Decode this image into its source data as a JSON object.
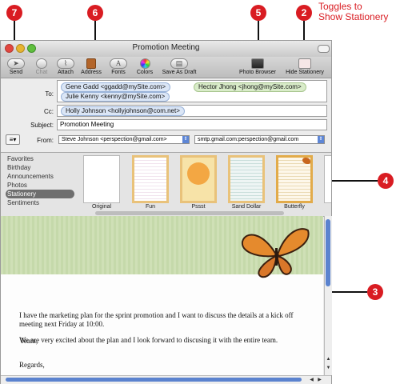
{
  "annotation_text": "Toggles to\nShow Stationery",
  "callouts": [
    "7",
    "6",
    "5",
    "2",
    "4",
    "3"
  ],
  "window": {
    "title": "Promotion Meeting"
  },
  "toolbar": {
    "items": [
      {
        "label": "Send",
        "icon": "send-icon"
      },
      {
        "label": "Chat",
        "icon": "chat-icon"
      },
      {
        "label": "Attach",
        "icon": "paperclip-icon"
      },
      {
        "label": "Address",
        "icon": "address-book-icon"
      },
      {
        "label": "Fonts",
        "icon": "fonts-icon"
      },
      {
        "label": "Colors",
        "icon": "colors-icon"
      },
      {
        "label": "Save As Draft",
        "icon": "draft-icon"
      },
      {
        "label": "Photo Browser",
        "icon": "photo-browser-icon"
      },
      {
        "label": "Hide Stationery",
        "icon": "stationery-icon"
      }
    ]
  },
  "headers": {
    "to_label": "To:",
    "to_tokens": [
      "Gene Gadd <ggadd@mySite.com>",
      "Hector Jhong <jhong@mySite.com>",
      "Julie Kenny <kenny@mySite.com>"
    ],
    "cc_label": "Cc:",
    "cc_tokens": [
      "Holly Johnson <hollyjohnson@com.net>"
    ],
    "subject_label": "Subject:",
    "subject_value": "Promotion Meeting",
    "from_label": "From:",
    "from_value": "Steve Johnson <perspection@gmail.com>",
    "smtp_value": "smtp.gmail.com:perspection@gmail.com"
  },
  "stationery": {
    "categories": [
      "Favorites",
      "Birthday",
      "Announcements",
      "Photos",
      "Stationery",
      "Sentiments"
    ],
    "selected_category": "Stationery",
    "templates": [
      "Original",
      "Fun",
      "Pssst",
      "Sand Dollar",
      "Butterfly"
    ]
  },
  "message": {
    "greeting": "Team,",
    "paragraph1": "I have the marketing plan for the sprint promotion and I want to discuss the details at a kick off meeting next Friday at 10:00.",
    "paragraph2": "We are very excited about the plan and I look forward to discusing it with the entire team.",
    "closing": "Regards,"
  },
  "colors": {
    "callout": "#d91c22",
    "annotation_text": "#d91c22",
    "token_blue": "#dbe6f6",
    "token_green": "#d9ecc9",
    "banner_green": "#cfe0b6"
  }
}
